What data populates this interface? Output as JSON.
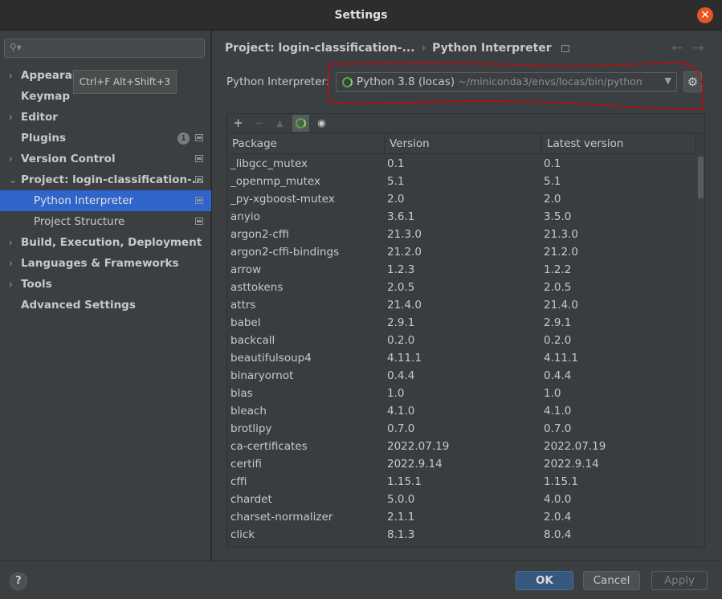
{
  "window": {
    "title": "Settings"
  },
  "sidebar": {
    "search_placeholder": "",
    "items": [
      {
        "label": "Appearance & Behavior",
        "expandable": true,
        "expanded": false
      },
      {
        "label": "Keymap",
        "expandable": false
      },
      {
        "label": "Editor",
        "expandable": true,
        "expanded": false
      },
      {
        "label": "Plugins",
        "expandable": false,
        "badge": "1"
      },
      {
        "label": "Version Control",
        "expandable": true,
        "expanded": false
      },
      {
        "label": "Project: login-classification-...",
        "expandable": true,
        "expanded": true
      },
      {
        "label": "Python Interpreter",
        "child": true,
        "selected": true
      },
      {
        "label": "Project Structure",
        "child": true
      },
      {
        "label": "Build, Execution, Deployment",
        "expandable": true,
        "expanded": false
      },
      {
        "label": "Languages & Frameworks",
        "expandable": true,
        "expanded": false
      },
      {
        "label": "Tools",
        "expandable": true,
        "expanded": false
      },
      {
        "label": "Advanced Settings",
        "expandable": false
      }
    ]
  },
  "tooltip": {
    "text": "Ctrl+F Alt+Shift+3"
  },
  "main": {
    "breadcrumb": {
      "parent": "Project: login-classification-...",
      "separator": "›",
      "current": "Python Interpreter"
    },
    "nav": {
      "back": "←",
      "forward": "→"
    },
    "interpreter": {
      "label": "Python Interpreter:",
      "name": "Python 3.8 (locas)",
      "path": "~/miniconda3/envs/locas/bin/python"
    },
    "toolbar": {
      "add": "+",
      "remove": "−",
      "upgrade": "▲",
      "show": "👁"
    },
    "table": {
      "columns": [
        "Package",
        "Version",
        "Latest version"
      ],
      "rows": [
        [
          "_libgcc_mutex",
          "0.1",
          "0.1"
        ],
        [
          "_openmp_mutex",
          "5.1",
          "5.1"
        ],
        [
          "_py-xgboost-mutex",
          "2.0",
          "2.0"
        ],
        [
          "anyio",
          "3.6.1",
          "3.5.0"
        ],
        [
          "argon2-cffi",
          "21.3.0",
          "21.3.0"
        ],
        [
          "argon2-cffi-bindings",
          "21.2.0",
          "21.2.0"
        ],
        [
          "arrow",
          "1.2.3",
          "1.2.2"
        ],
        [
          "asttokens",
          "2.0.5",
          "2.0.5"
        ],
        [
          "attrs",
          "21.4.0",
          "21.4.0"
        ],
        [
          "babel",
          "2.9.1",
          "2.9.1"
        ],
        [
          "backcall",
          "0.2.0",
          "0.2.0"
        ],
        [
          "beautifulsoup4",
          "4.11.1",
          "4.11.1"
        ],
        [
          "binaryornot",
          "0.4.4",
          "0.4.4"
        ],
        [
          "blas",
          "1.0",
          "1.0"
        ],
        [
          "bleach",
          "4.1.0",
          "4.1.0"
        ],
        [
          "brotlipy",
          "0.7.0",
          "0.7.0"
        ],
        [
          "ca-certificates",
          "2022.07.19",
          "2022.07.19"
        ],
        [
          "certifi",
          "2022.9.14",
          "2022.9.14"
        ],
        [
          "cffi",
          "1.15.1",
          "1.15.1"
        ],
        [
          "chardet",
          "5.0.0",
          "4.0.0"
        ],
        [
          "charset-normalizer",
          "2.1.1",
          "2.0.4"
        ],
        [
          "click",
          "8.1.3",
          "8.0.4"
        ]
      ]
    }
  },
  "footer": {
    "help": "?",
    "ok": "OK",
    "cancel": "Cancel",
    "apply": "Apply"
  },
  "colors": {
    "selection": "#2f65ca",
    "ok_button": "#365880",
    "close_button": "#e95420",
    "annotation": "#e00000",
    "status_ring": "#4cae3c"
  }
}
